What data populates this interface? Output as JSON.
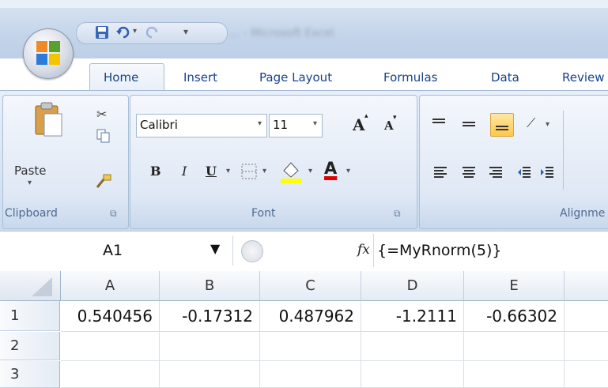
{
  "qat": {
    "title_blur": "... - Microsoft Excel"
  },
  "tabs": [
    "Home",
    "Insert",
    "Page Layout",
    "Formulas",
    "Data",
    "Review"
  ],
  "clipboard": {
    "paste_label": "Paste",
    "group_label": "Clipboard"
  },
  "font": {
    "font_name": "Calibri",
    "font_size": "11",
    "group_label": "Font",
    "bold": "B",
    "italic": "I",
    "underline": "U",
    "grow": "A",
    "shrink": "A",
    "font_color": "A"
  },
  "alignment": {
    "group_label": "Alignme"
  },
  "formula_bar": {
    "name_box": "A1",
    "fx": "fx",
    "formula": "{=MyRnorm(5)}"
  },
  "grid": {
    "columns": [
      "A",
      "B",
      "C",
      "D",
      "E"
    ],
    "rows": [
      {
        "label": "1",
        "cells": [
          "0.540456",
          "-0.17312",
          "0.487962",
          "-1.2111",
          "-0.66302"
        ]
      },
      {
        "label": "2",
        "cells": [
          "",
          "",
          "",
          "",
          ""
        ]
      },
      {
        "label": "3",
        "cells": [
          "",
          "",
          "",
          "",
          ""
        ]
      }
    ]
  },
  "colors": {
    "ribbon": "#dfe8f5",
    "tab_text": "#15428b",
    "highlight": "#ffd54a",
    "font_red": "#e00000"
  }
}
